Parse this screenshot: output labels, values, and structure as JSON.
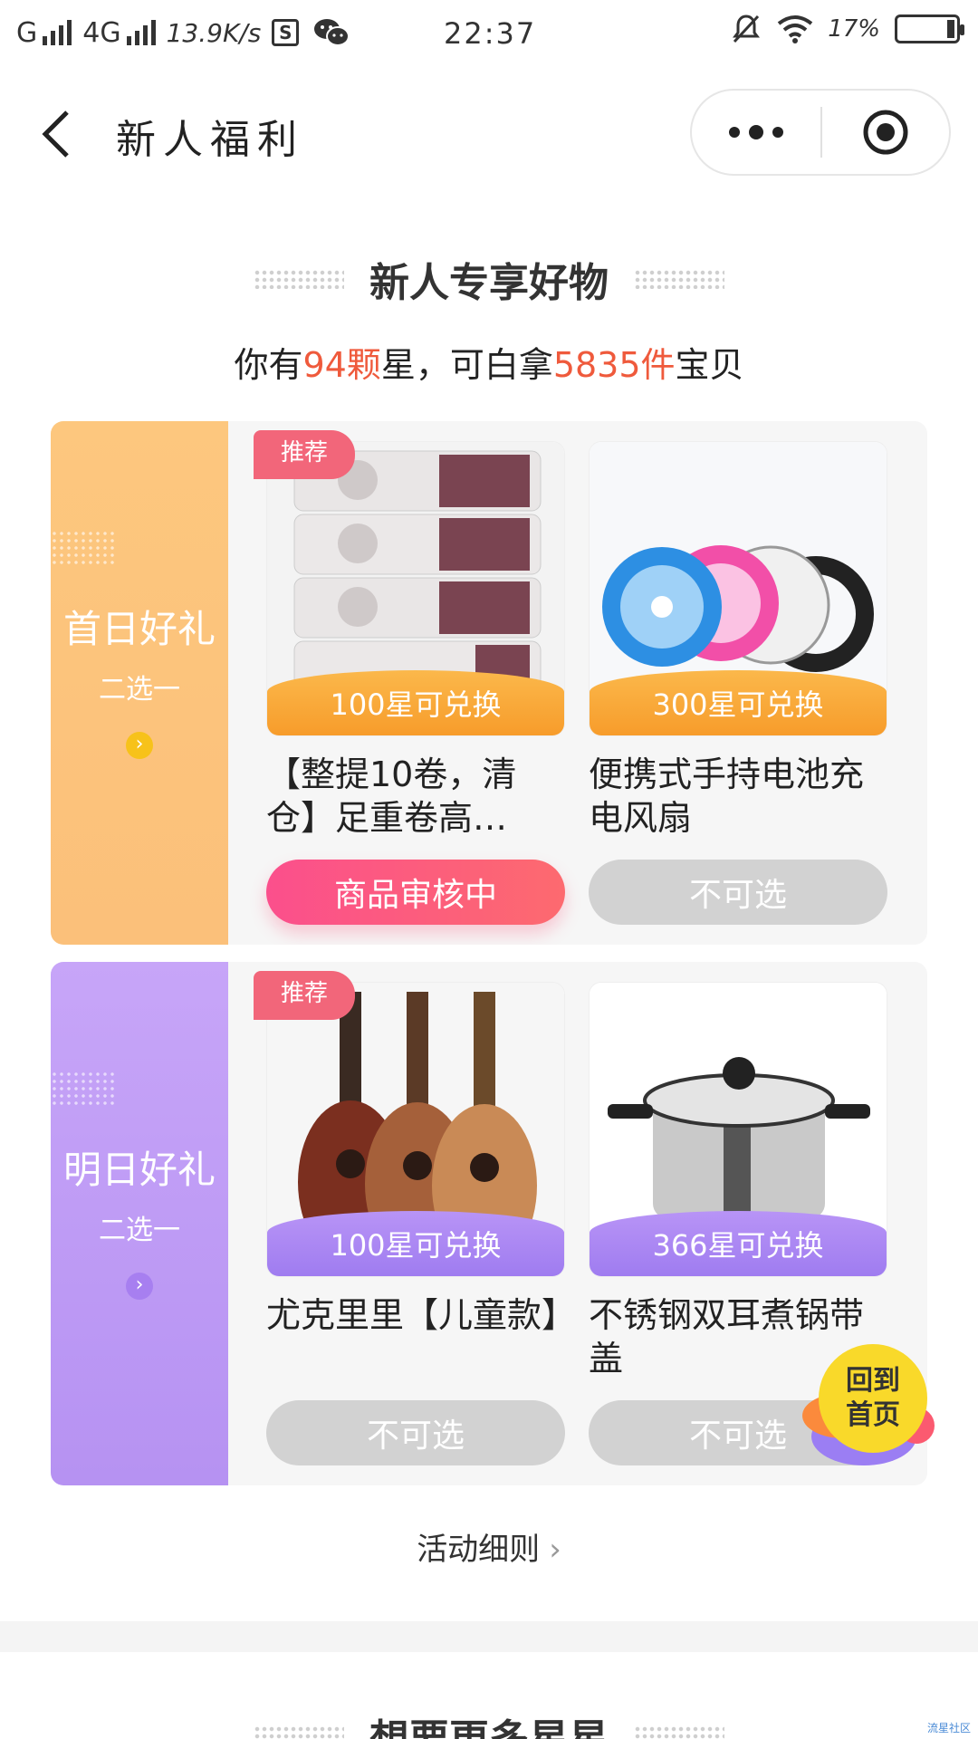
{
  "status_bar": {
    "carrier1": "G",
    "carrier2": "4G",
    "speed": "13.9K/s",
    "s_icon": "S",
    "time": "22:37",
    "battery": "17%"
  },
  "nav": {
    "title": "新人福利"
  },
  "section": {
    "title": "新人专享好物",
    "sub_prefix": "你有",
    "stars": "94颗",
    "sub_mid": "星，可白拿",
    "items_count": "5835件",
    "sub_suffix": "宝贝"
  },
  "gifts": [
    {
      "title": "首日好礼",
      "subtitle": "二选一",
      "arrow": "›",
      "items": [
        {
          "tag": "推荐",
          "ribbon": "100星可兑换",
          "name": "【整提10卷，清仓】足重卷高…",
          "button": "商品审核中",
          "image": "toilet-paper-pack"
        },
        {
          "tag": "",
          "ribbon": "300星可兑换",
          "name": "便携式手持电池充电风扇",
          "button": "不可选",
          "image": "handheld-fans"
        }
      ]
    },
    {
      "title": "明日好礼",
      "subtitle": "二选一",
      "arrow": "›",
      "items": [
        {
          "tag": "推荐",
          "ribbon": "100星可兑换",
          "name": "尤克里里【儿童款】",
          "button": "不可选",
          "image": "ukuleles"
        },
        {
          "tag": "",
          "ribbon": "366星可兑换",
          "name": "不锈钢双耳煮锅带盖",
          "button": "不可选",
          "image": "steel-pot"
        }
      ]
    }
  ],
  "home_fab": {
    "line1": "回到",
    "line2": "首页"
  },
  "rules": {
    "label": "活动细则",
    "chevron": "›"
  },
  "section2": {
    "title": "想要更多星星"
  },
  "watermark": "流星社区",
  "colors": {
    "highlight": "#ef5a3c",
    "day1": "#fbc07a",
    "day2": "#b692f2",
    "review_button": "#fb4f8c",
    "disabled_button": "#d2d2d2"
  }
}
